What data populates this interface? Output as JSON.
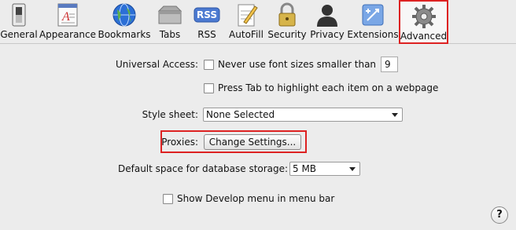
{
  "toolbar": {
    "items": [
      {
        "label": "General",
        "icon": "switch-icon"
      },
      {
        "label": "Appearance",
        "icon": "font-icon"
      },
      {
        "label": "Bookmarks",
        "icon": "globe-icon"
      },
      {
        "label": "Tabs",
        "icon": "tabs-icon"
      },
      {
        "label": "RSS",
        "icon": "rss-icon"
      },
      {
        "label": "AutoFill",
        "icon": "pencil-form-icon"
      },
      {
        "label": "Security",
        "icon": "lock-icon"
      },
      {
        "label": "Privacy",
        "icon": "person-silhouette-icon"
      },
      {
        "label": "Extensions",
        "icon": "extensions-icon"
      },
      {
        "label": "Advanced",
        "icon": "gear-icon",
        "selected": true
      }
    ],
    "rss_badge": "RSS"
  },
  "advanced": {
    "universal_access_label": "Universal Access:",
    "min_font_label": "Never use font sizes smaller than",
    "min_font_value": "9",
    "tab_highlight_label": "Press Tab to highlight each item on a webpage",
    "style_sheet_label": "Style sheet:",
    "style_sheet_value": "None Selected",
    "proxies_label": "Proxies:",
    "proxies_button": "Change Settings...",
    "db_storage_label": "Default space for database storage:",
    "db_storage_value": "5 MB",
    "develop_menu_label": "Show Develop menu in menu bar"
  },
  "help_label": "?",
  "colors": {
    "highlight": "#dd2222",
    "background": "#ececec"
  }
}
